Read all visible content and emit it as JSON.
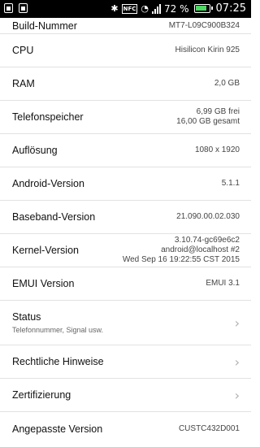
{
  "status_bar": {
    "time": "07:25",
    "battery_percent": "72 %",
    "battery_level": 0.72
  },
  "items": [
    {
      "label": "Build-Nummer",
      "value": "MT7-L09C900B324"
    },
    {
      "label": "CPU",
      "value": "Hisilicon Kirin 925"
    },
    {
      "label": "RAM",
      "value": "2,0 GB"
    },
    {
      "label": "Telefonspeicher",
      "value_lines": [
        "6,99  GB frei",
        "16,00  GB gesamt"
      ]
    },
    {
      "label": "Auflösung",
      "value": "1080 x 1920"
    },
    {
      "label": "Android-Version",
      "value": "5.1.1"
    },
    {
      "label": "Baseband-Version",
      "value": "21.090.00.02.030"
    },
    {
      "label": "Kernel-Version",
      "value_lines": [
        "3.10.74-gc69e6c2",
        "android@localhost #2",
        "Wed Sep 16 19:22:55 CST 2015"
      ]
    },
    {
      "label": "EMUI Version",
      "value": "EMUI 3.1"
    },
    {
      "label": "Status",
      "subtitle": "Telefonnummer, Signal usw."
    },
    {
      "label": "Rechtliche Hinweise"
    },
    {
      "label": "Zertifizierung"
    },
    {
      "label": "Angepasste Version",
      "value": "CUSTC432D001"
    }
  ]
}
